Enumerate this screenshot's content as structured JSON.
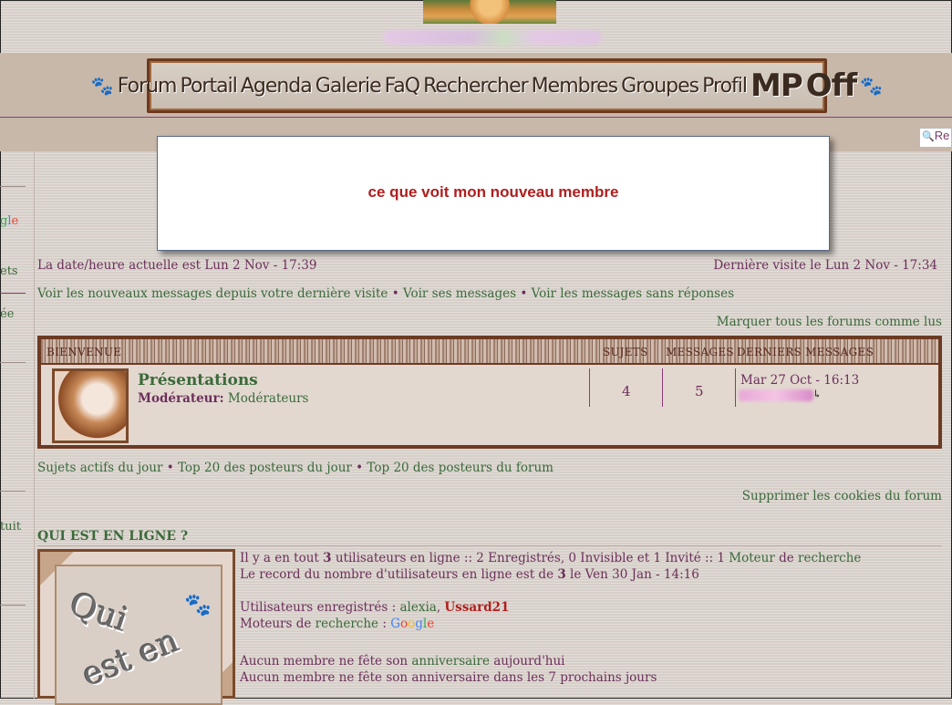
{
  "navbar": {
    "items": [
      "Forum",
      "Portail",
      "Agenda",
      "Galerie",
      "FaQ",
      "Rechercher",
      "Membres",
      "Groupes",
      "Profil",
      "MP",
      "Off"
    ]
  },
  "search": {
    "label": "Re"
  },
  "left_sidebar": {
    "fragments": [
      "gle",
      "ets",
      "ée",
      "tuit"
    ]
  },
  "popup": {
    "message": "ce que voit mon nouveau membre"
  },
  "datetime": {
    "current": "La date/heure actuelle est Lun 2 Nov - 17:39",
    "last_visit": "Dernière visite le Lun 2 Nov - 17:34"
  },
  "quick_links": {
    "new_since": "Voir les nouveaux messages depuis votre dernière visite",
    "own": "Voir ses messages",
    "unanswered": "Voir les messages sans réponses",
    "mark_read": "Marquer tous les forums comme lus"
  },
  "forum_table": {
    "headers": {
      "category": "BIENVENUE",
      "topics": "SUJETS",
      "messages": "MESSAGES",
      "last": "DERNIERS MESSAGES"
    },
    "forum": {
      "title": "Présentations",
      "moderator_label": "Modérateur:",
      "moderator": "Modérateurs",
      "topics": "4",
      "messages": "5",
      "last_post_date": "Mar 27 Oct - 16:13"
    }
  },
  "bottom_links": {
    "active": "Sujets actifs du jour",
    "top_day": "Top 20 des posteurs du jour",
    "top_forum": "Top 20 des posteurs du forum",
    "cookies": "Supprimer les cookies du forum"
  },
  "who": {
    "title": "QUI EST EN LIGNE ?",
    "image_text": "Qui est en ligne ?",
    "line1_a": "Il y a en tout ",
    "line1_count": "3",
    "line1_b": " utilisateurs en ligne :: 2 Enregistrés, 0 Invisible et 1 Invité :: 1 ",
    "line1_moteur": "Moteur",
    "line1_de": " de ",
    "line1_recherche": "recherche",
    "line2_a": "Le record du nombre d'utilisateurs en ligne est de ",
    "line2_count": "3",
    "line2_b": " le Ven 30 Jan - 14:16",
    "registered_label": "Utilisateurs enregistrés : ",
    "user1": "alexia",
    "comma": ", ",
    "user2": "Ussard21",
    "engines_label": "Moteurs de ",
    "engines_link": "recherche",
    "engines_colon": " : ",
    "google": [
      "G",
      "o",
      "o",
      "g",
      "l",
      "e"
    ],
    "birthday1_a": "Aucun membre ne fête son ",
    "birthday1_link": "anniversaire",
    "birthday1_b": " aujourd'hui",
    "birthday2": "Aucun membre ne fête son anniversaire dans les 7 prochains jours"
  },
  "separator": " • ",
  "colors": {
    "link": "#3a6a3a",
    "text": "#6b2f5a",
    "accent_red": "#b01e1e",
    "frame": "#6b3a22"
  }
}
